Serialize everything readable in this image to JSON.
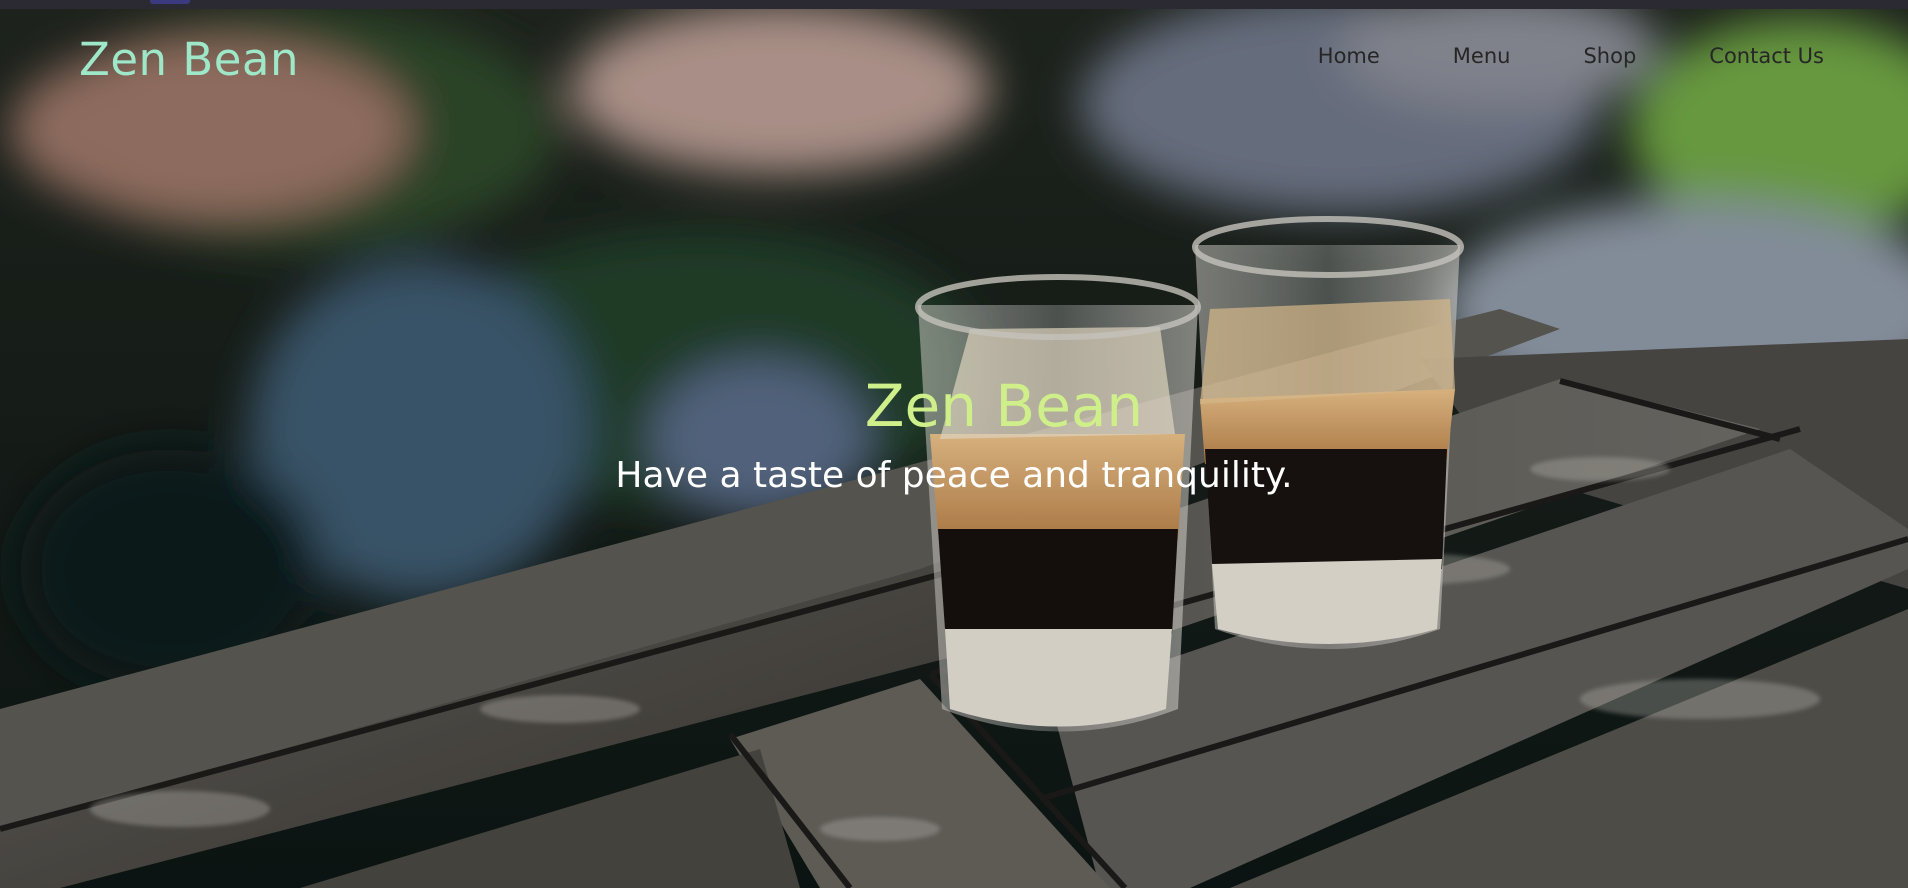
{
  "navbar": {
    "brand": "Zen Bean",
    "links": [
      "Home",
      "Menu",
      "Shop",
      "Contact Us"
    ]
  },
  "hero": {
    "title": "Zen Bean",
    "tagline": "Have a taste of peace and tranquility.",
    "background_image": "two-layered-coffee-glasses-on-wooden-table-by-pond"
  },
  "colors": {
    "brand": "#9ee7c8",
    "hero_title": "#cfef8a",
    "nav_link": "#262626",
    "tagline": "#ffffff"
  }
}
